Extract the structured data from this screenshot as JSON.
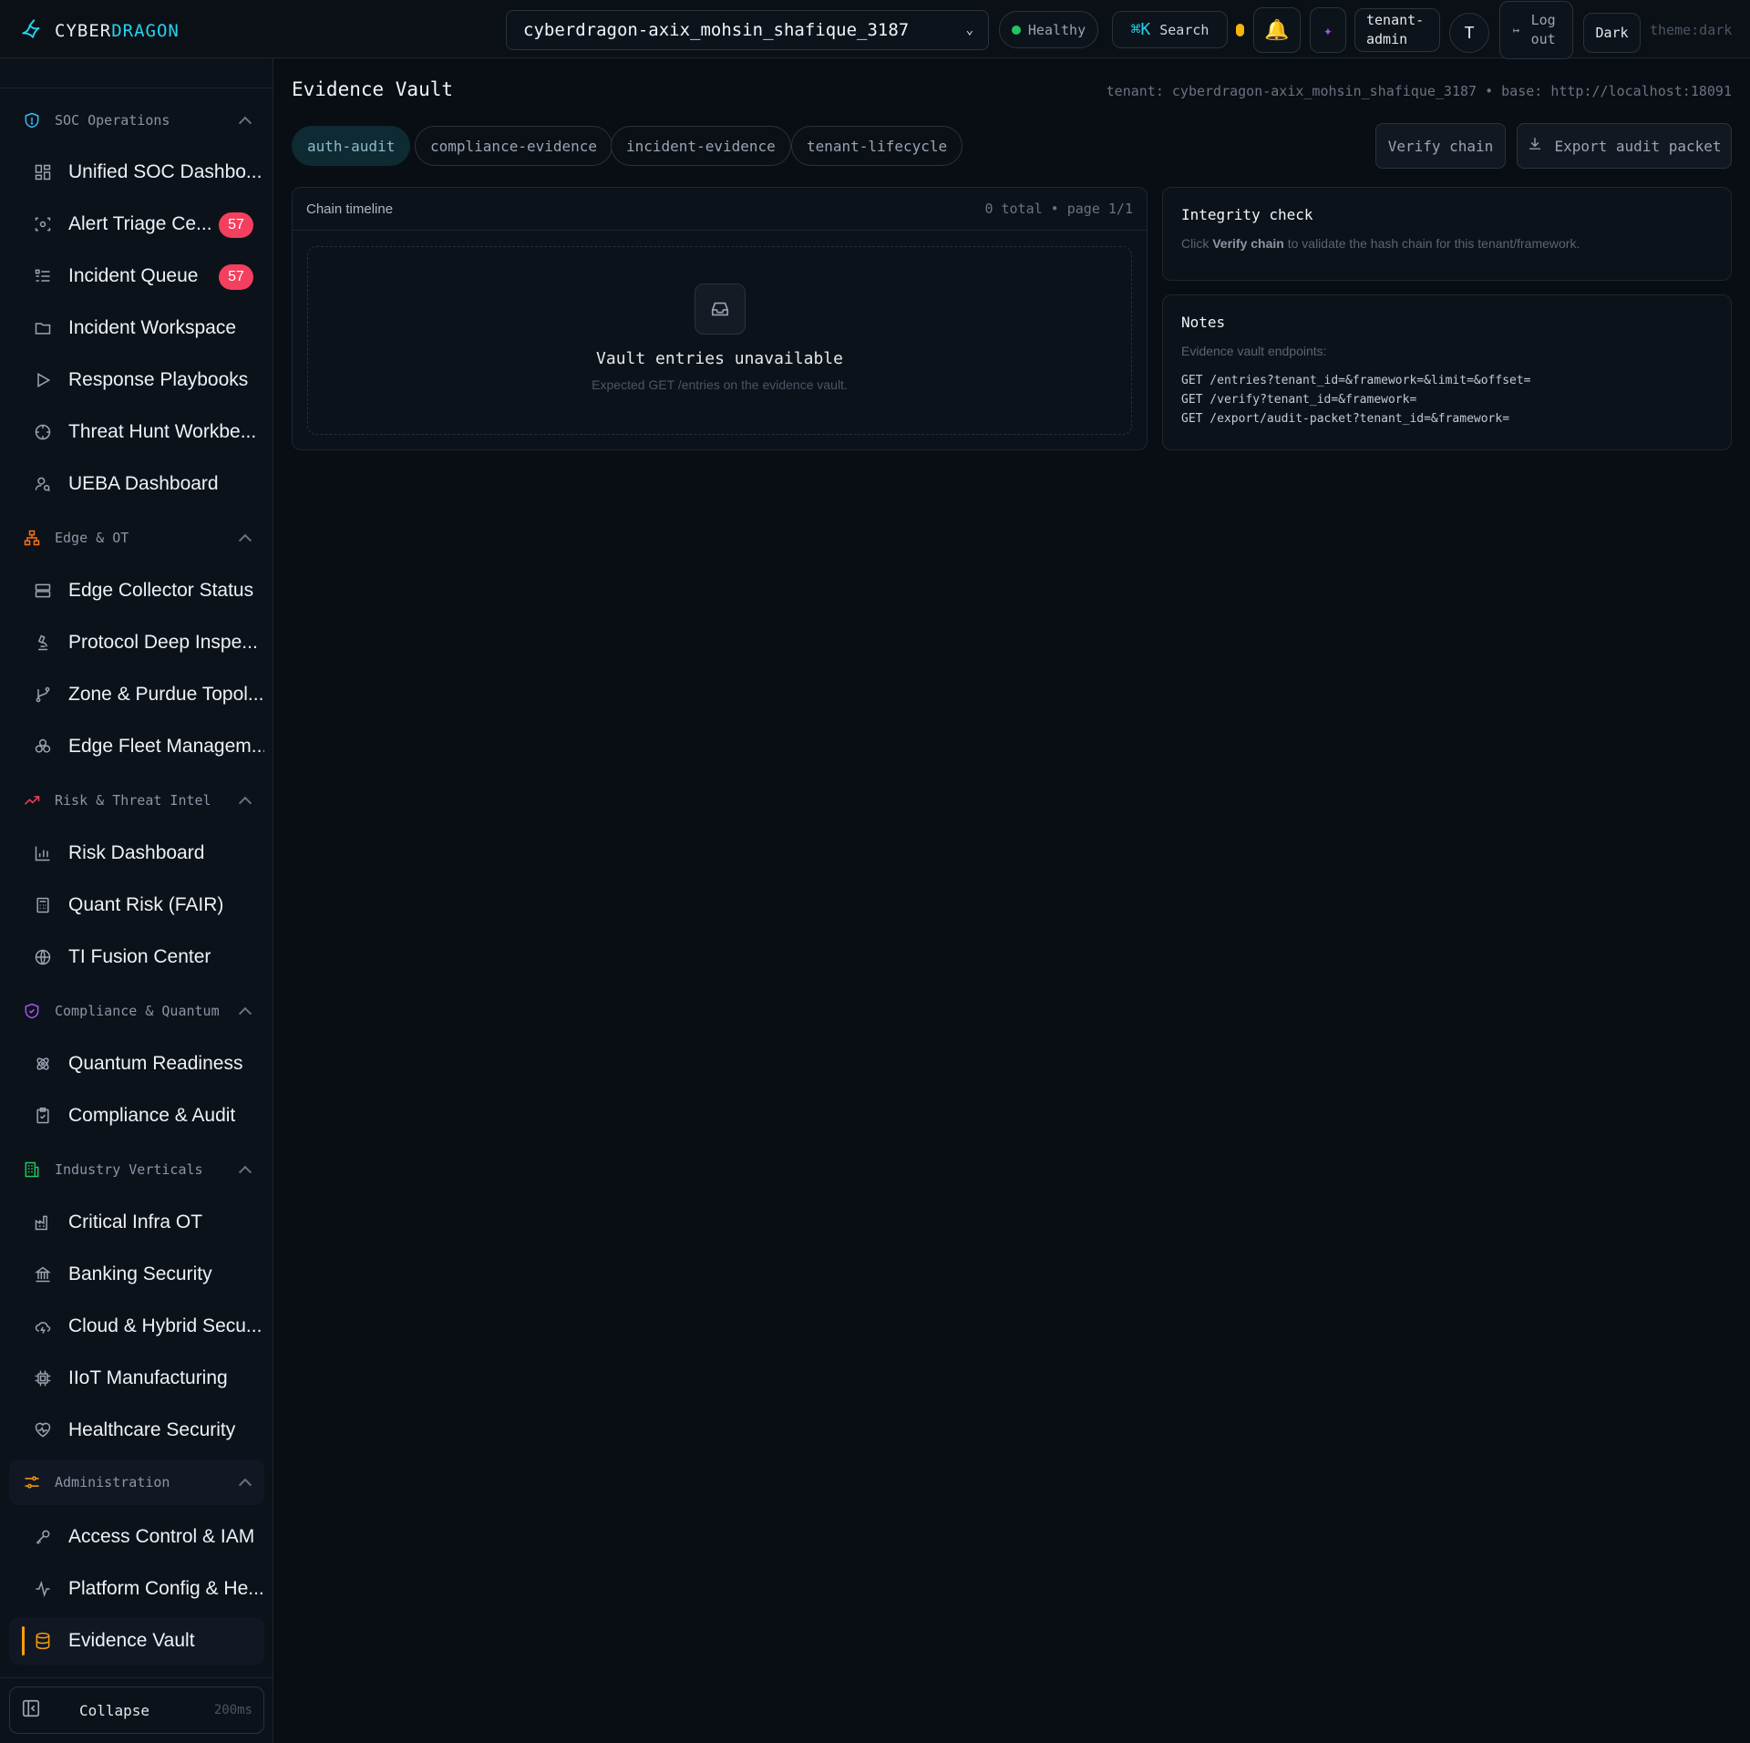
{
  "brand": {
    "prefix": "CYBER",
    "accent": "DRAGON"
  },
  "header": {
    "tenant_select": "cyberdragon-axix_mohsin_shafique_3187",
    "health": "Healthy",
    "search_kbd": "⌘K",
    "search_label": "Search",
    "role": "tenant-admin",
    "avatar": "T",
    "logout": "Log out",
    "theme_button": "Dark",
    "theme_tag": "theme:dark"
  },
  "sidebar": {
    "sections": [
      {
        "label": "SOC Operations",
        "icon": "shield-icon",
        "color": "#38bdf8"
      },
      {
        "label": "Edge & OT",
        "icon": "network-icon",
        "color": "#f97316"
      },
      {
        "label": "Risk & Threat Intel",
        "icon": "trending-up-icon",
        "color": "#f43f5e"
      },
      {
        "label": "Compliance & Quantum",
        "icon": "shield-check-icon",
        "color": "#a855f7"
      },
      {
        "label": "Industry Verticals",
        "icon": "building-icon",
        "color": "#22c55e"
      },
      {
        "label": "Administration",
        "icon": "sliders-icon",
        "color": "#f59e0b"
      }
    ],
    "items": [
      {
        "label": "Unified SOC Dashbo...",
        "icon": "dashboard-grid-icon"
      },
      {
        "label": "Alert Triage Ce...",
        "icon": "scan-eye-icon",
        "badge": "57"
      },
      {
        "label": "Incident Queue",
        "icon": "list-icon",
        "badge": "57"
      },
      {
        "label": "Incident Workspace",
        "icon": "folder-icon"
      },
      {
        "label": "Response Playbooks",
        "icon": "play-icon"
      },
      {
        "label": "Threat Hunt Workbe...",
        "icon": "crosshair-icon"
      },
      {
        "label": "UEBA Dashboard",
        "icon": "user-search-icon"
      },
      {
        "label": "Edge Collector Status",
        "icon": "server-icon"
      },
      {
        "label": "Protocol Deep Inspe...",
        "icon": "microscope-icon"
      },
      {
        "label": "Zone & Purdue Topol...",
        "icon": "git-branch-icon"
      },
      {
        "label": "Edge Fleet Managem...",
        "icon": "boxes-icon"
      },
      {
        "label": "Risk Dashboard",
        "icon": "bar-chart-icon"
      },
      {
        "label": "Quant Risk (FAIR)",
        "icon": "calculator-icon"
      },
      {
        "label": "TI Fusion Center",
        "icon": "globe-icon"
      },
      {
        "label": "Quantum Readiness",
        "icon": "atom-icon"
      },
      {
        "label": "Compliance & Audit",
        "icon": "clipboard-check-icon"
      },
      {
        "label": "Critical Infra OT",
        "icon": "factory-icon"
      },
      {
        "label": "Banking Security",
        "icon": "landmark-icon"
      },
      {
        "label": "Cloud & Hybrid Secu...",
        "icon": "cloud-icon"
      },
      {
        "label": "IIoT Manufacturing",
        "icon": "cpu-icon"
      },
      {
        "label": "Healthcare Security",
        "icon": "heart-pulse-icon"
      },
      {
        "label": "Access Control & IAM",
        "icon": "key-icon"
      },
      {
        "label": "Platform Config & He...",
        "icon": "activity-icon"
      },
      {
        "label": "Evidence Vault",
        "icon": "database-icon",
        "active": true
      }
    ],
    "collapse": {
      "label": "Collapse",
      "ms": "200ms"
    }
  },
  "main": {
    "title": "Evidence Vault",
    "tenant_info": "tenant: cyberdragon-axix_mohsin_shafique_3187 • base: http://localhost:18091",
    "frameworks": [
      "auth-audit",
      "compliance-evidence",
      "incident-evidence",
      "tenant-lifecycle"
    ],
    "active_framework": "auth-audit",
    "verify_button": "Verify chain",
    "export_button": "Export audit packet",
    "timeline": {
      "title": "Chain timeline",
      "count": "0 total • page 1/1",
      "empty_title": "Vault entries unavailable",
      "empty_subtitle": "Expected GET /entries on the evidence vault."
    },
    "integrity": {
      "title": "Integrity check",
      "text_pre": "Click ",
      "text_bold": "Verify chain",
      "text_post": " to validate the hash chain for this tenant/framework."
    },
    "notes": {
      "title": "Notes",
      "subtitle": "Evidence vault endpoints:",
      "endpoints": [
        "GET /entries?tenant_id=&framework=&limit=&offset=",
        "GET /verify?tenant_id=&framework=",
        "GET /export/audit-packet?tenant_id=&framework="
      ]
    }
  }
}
